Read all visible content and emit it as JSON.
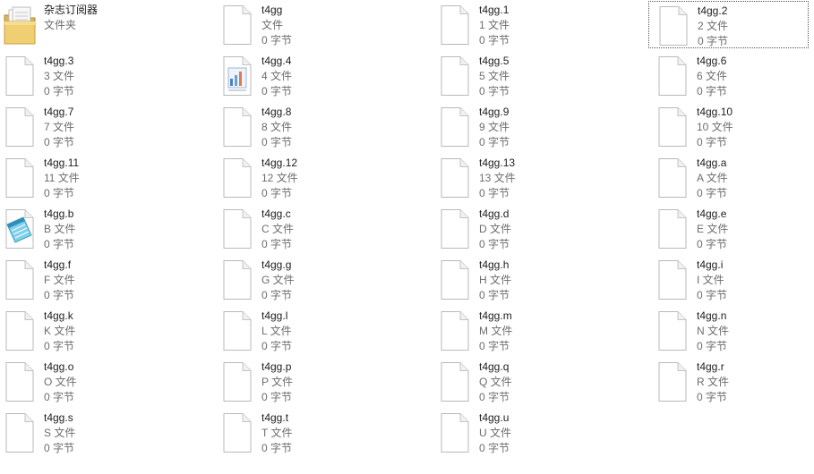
{
  "files": [
    {
      "name": "杂志订阅器",
      "type": "文件夹",
      "size": "",
      "icon": "folder-icon"
    },
    {
      "name": "t4gg",
      "type": "文件",
      "size": "0 字节",
      "icon": "file-icon"
    },
    {
      "name": "t4gg.1",
      "type": "1 文件",
      "size": "0 字节",
      "icon": "file-icon"
    },
    {
      "name": "t4gg.2",
      "type": "2 文件",
      "size": "0 字节",
      "icon": "file-icon",
      "selected": true
    },
    {
      "name": "t4gg.3",
      "type": "3 文件",
      "size": "0 字节",
      "icon": "file-icon"
    },
    {
      "name": "t4gg.4",
      "type": "4 文件",
      "size": "0 字节",
      "icon": "document-chart-icon"
    },
    {
      "name": "t4gg.5",
      "type": "5 文件",
      "size": "0 字节",
      "icon": "file-icon"
    },
    {
      "name": "t4gg.6",
      "type": "6 文件",
      "size": "0 字节",
      "icon": "file-icon"
    },
    {
      "name": "t4gg.7",
      "type": "7 文件",
      "size": "0 字节",
      "icon": "file-icon"
    },
    {
      "name": "t4gg.8",
      "type": "8 文件",
      "size": "0 字节",
      "icon": "file-icon"
    },
    {
      "name": "t4gg.9",
      "type": "9 文件",
      "size": "0 字节",
      "icon": "file-icon"
    },
    {
      "name": "t4gg.10",
      "type": "10 文件",
      "size": "0 字节",
      "icon": "file-icon"
    },
    {
      "name": "t4gg.11",
      "type": "11 文件",
      "size": "0 字节",
      "icon": "file-icon"
    },
    {
      "name": "t4gg.12",
      "type": "12 文件",
      "size": "0 字节",
      "icon": "file-icon"
    },
    {
      "name": "t4gg.13",
      "type": "13 文件",
      "size": "0 字节",
      "icon": "file-icon"
    },
    {
      "name": "t4gg.a",
      "type": "A 文件",
      "size": "0 字节",
      "icon": "file-icon"
    },
    {
      "name": "t4gg.b",
      "type": "B 文件",
      "size": "0 字节",
      "icon": "notepad-icon"
    },
    {
      "name": "t4gg.c",
      "type": "C 文件",
      "size": "0 字节",
      "icon": "file-icon"
    },
    {
      "name": "t4gg.d",
      "type": "D 文件",
      "size": "0 字节",
      "icon": "file-icon"
    },
    {
      "name": "t4gg.e",
      "type": "E 文件",
      "size": "0 字节",
      "icon": "file-icon"
    },
    {
      "name": "t4gg.f",
      "type": "F 文件",
      "size": "0 字节",
      "icon": "file-icon"
    },
    {
      "name": "t4gg.g",
      "type": "G 文件",
      "size": "0 字节",
      "icon": "file-icon"
    },
    {
      "name": "t4gg.h",
      "type": "H 文件",
      "size": "0 字节",
      "icon": "file-icon"
    },
    {
      "name": "t4gg.i",
      "type": "I 文件",
      "size": "0 字节",
      "icon": "file-icon"
    },
    {
      "name": "t4gg.k",
      "type": "K 文件",
      "size": "0 字节",
      "icon": "file-icon"
    },
    {
      "name": "t4gg.l",
      "type": "L 文件",
      "size": "0 字节",
      "icon": "file-icon"
    },
    {
      "name": "t4gg.m",
      "type": "M 文件",
      "size": "0 字节",
      "icon": "file-icon"
    },
    {
      "name": "t4gg.n",
      "type": "N 文件",
      "size": "0 字节",
      "icon": "file-icon"
    },
    {
      "name": "t4gg.o",
      "type": "O 文件",
      "size": "0 字节",
      "icon": "file-icon"
    },
    {
      "name": "t4gg.p",
      "type": "P 文件",
      "size": "0 字节",
      "icon": "file-icon"
    },
    {
      "name": "t4gg.q",
      "type": "Q 文件",
      "size": "0 字节",
      "icon": "file-icon"
    },
    {
      "name": "t4gg.r",
      "type": "R 文件",
      "size": "0 字节",
      "icon": "file-icon"
    },
    {
      "name": "t4gg.s",
      "type": "S 文件",
      "size": "0 字节",
      "icon": "file-icon"
    },
    {
      "name": "t4gg.t",
      "type": "T 文件",
      "size": "0 字节",
      "icon": "file-icon"
    },
    {
      "name": "t4gg.u",
      "type": "U 文件",
      "size": "0 字节",
      "icon": "file-icon"
    }
  ]
}
